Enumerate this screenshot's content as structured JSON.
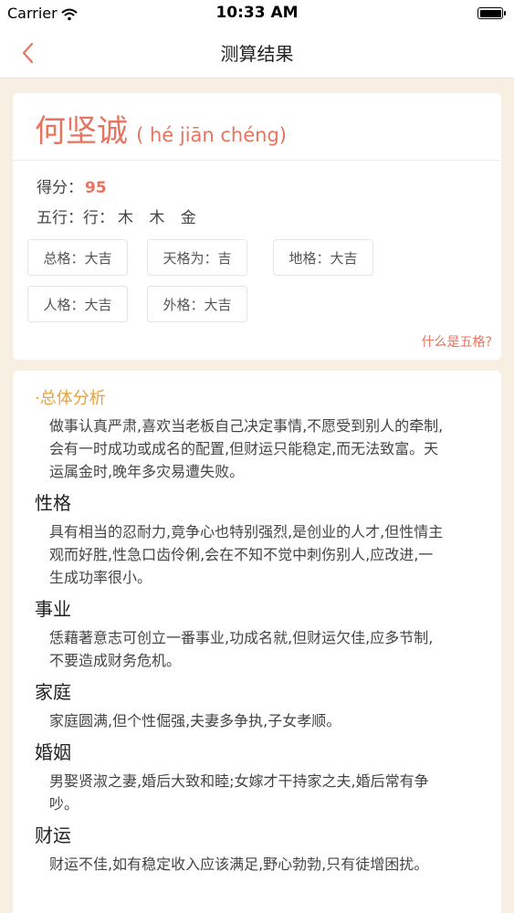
{
  "status_bar": {
    "carrier": "Carrier",
    "time": "10:33 AM"
  },
  "nav": {
    "title": "测算结果"
  },
  "name_card": {
    "name": "何坚诚",
    "pinyin": "( hé jiān chéng)",
    "score_label": "得分：",
    "score_value": "95",
    "wuxing_label": "五行：行：",
    "wuxing_value": "木 木 金",
    "tags": [
      "总格：大吉",
      "天格为：吉",
      "地格：大吉",
      "人格：大吉",
      "外格：大吉"
    ],
    "link": "什么是五格?"
  },
  "analysis": {
    "overall_title": "·总体分析",
    "overall_text": "做事认真严肃,喜欢当老板自己决定事情,不愿受到别人的牵制,会有一时成功或成名的配置,但财运只能稳定,而无法致富。天运属金时,晚年多灾易遭失败。",
    "sections": [
      {
        "title": "性格",
        "text": "具有相当的忍耐力,竟争心也特别强烈,是创业的人才,但性情主观而好胜,性急口齿伶俐,会在不知不觉中刺伤别人,应改进,一生成功率很小。"
      },
      {
        "title": "事业",
        "text": "恁藉著意志可创立一番事业,功成名就,但财运欠佳,应多节制,不要造成财务危机。"
      },
      {
        "title": "家庭",
        "text": "家庭圆满,但个性倔强,夫妻多争执,子女孝顺。"
      },
      {
        "title": "婚姻",
        "text": "男娶贤淑之妻,婚后大致和睦;女嫁才干持家之夫,婚后常有争吵。"
      },
      {
        "title": "财运",
        "text": "财运不佳,如有稳定收入应该满足,野心勃勃,只有徒增困扰。"
      }
    ]
  },
  "colors": {
    "accent": "#e8735e",
    "section_title": "#e8a23a",
    "background": "#f7efe1"
  }
}
